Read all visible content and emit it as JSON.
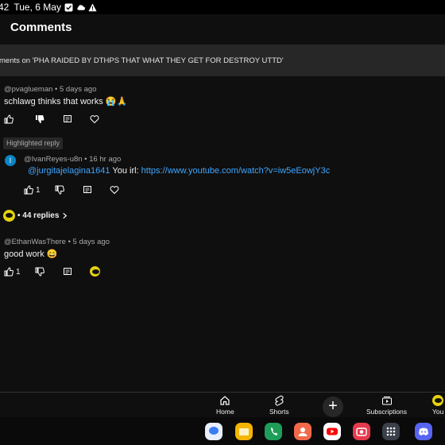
{
  "status": {
    "time": "42",
    "date": "Tue, 6 May"
  },
  "header": {
    "title": "Comments"
  },
  "banner": {
    "text": "ments on 'PHA RAIDED BY DTHPS THAT WHAT THEY GET FOR DESTROY UTTD'"
  },
  "comments": [
    {
      "author": "@pvaglueman • 5 days ago",
      "text": "schlawg thinks that works 😭🙏",
      "likes": ""
    },
    {
      "author": "@EthanWasThere • 5 days ago",
      "text": "good work 😄",
      "likes": "1"
    }
  ],
  "highlighted": {
    "label": "Highlighted reply",
    "avatar_letter": "I",
    "author": "@IvanReyes-u8n • 16 hr ago",
    "mention": "@jurgitajelagina1641",
    "text": " You irl: ",
    "link": "https://www.youtube.com/watch?v=iw5eEowjY3c",
    "likes": "1"
  },
  "replies": {
    "label": "• 44 replies"
  },
  "nav": {
    "home": "Home",
    "shorts": "Shorts",
    "subscriptions": "Subscriptions",
    "you": "You"
  },
  "colors": {
    "background": "#0f0f0f",
    "link": "#3ea6ff",
    "chip": "#272727"
  },
  "dock_apps": [
    "messages-icon",
    "files-icon",
    "phone-icon",
    "contacts-icon",
    "youtube-icon",
    "camera-icon",
    "apps-grid-icon",
    "discord-icon"
  ]
}
